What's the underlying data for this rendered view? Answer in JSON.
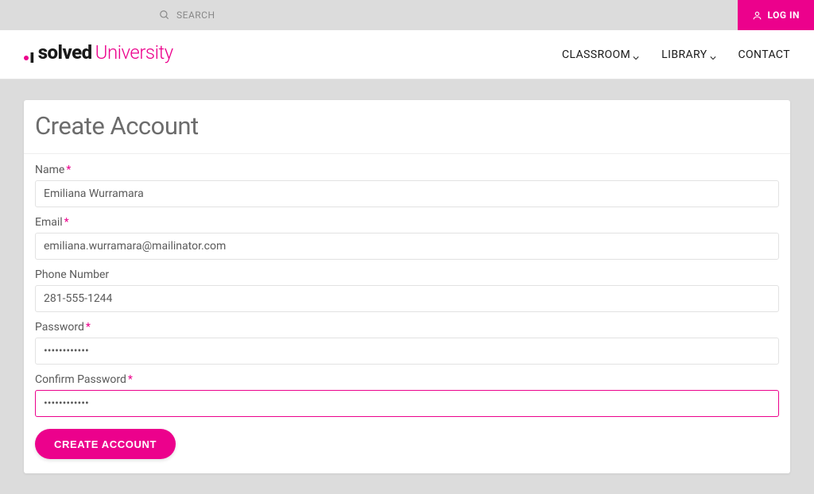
{
  "topbar": {
    "search_label": "SEARCH",
    "login_label": "LOG IN"
  },
  "brand": {
    "bold": "solved",
    "light": "University"
  },
  "nav": {
    "items": [
      {
        "label": "CLASSROOM",
        "has_dropdown": true
      },
      {
        "label": "LIBRARY",
        "has_dropdown": true
      },
      {
        "label": "CONTACT",
        "has_dropdown": false
      }
    ]
  },
  "page": {
    "title": "Create Account"
  },
  "form": {
    "fields": {
      "name": {
        "label": "Name",
        "required": true,
        "value": "Emiliana Wurramara"
      },
      "email": {
        "label": "Email",
        "required": true,
        "value": "emiliana.wurramara@mailinator.com"
      },
      "phone": {
        "label": "Phone Number",
        "required": false,
        "value": "281-555-1244"
      },
      "password": {
        "label": "Password",
        "required": true,
        "value": "••••••••••••"
      },
      "confirm": {
        "label": "Confirm Password",
        "required": true,
        "value": "••••••••••••",
        "focused": true
      }
    },
    "submit_label": "CREATE ACCOUNT"
  },
  "colors": {
    "accent": "#ec018c"
  }
}
